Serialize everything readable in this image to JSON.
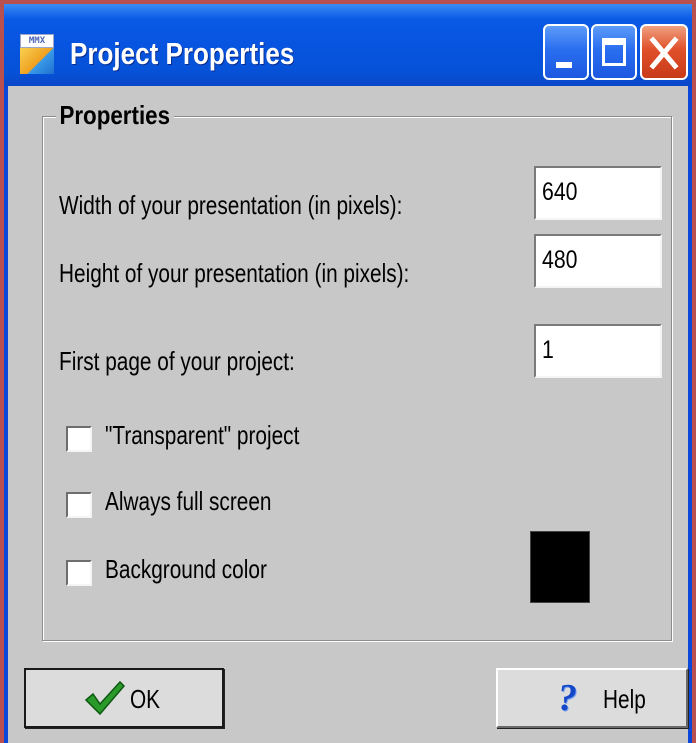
{
  "window": {
    "title": "Project Properties",
    "icon_text": "MMX",
    "controls": [
      "minimize-icon",
      "maximize-icon",
      "close-icon"
    ]
  },
  "group": {
    "legend": "Properties"
  },
  "fields": {
    "width_label": "Width of your presentation (in pixels):",
    "width_value": "640",
    "height_label": "Height of your presentation (in pixels):",
    "height_value": "480",
    "first_page_label": "First page of your project:",
    "first_page_value": "1"
  },
  "options": {
    "transparent_label": "\"Transparent\" project",
    "transparent_checked": false,
    "fullscreen_label": "Always full screen",
    "fullscreen_checked": false,
    "bg_color_label": "Background color",
    "bg_color_checked": false,
    "bg_color_value": "#000000"
  },
  "buttons": {
    "ok_label": "OK",
    "ok_icon": "checkmark-icon",
    "help_label": "Help",
    "help_icon": "question-mark-icon"
  },
  "colors": {
    "titlebar": "#0754e0",
    "dialog_bg": "#c8c8c8",
    "close_button": "#e0502a",
    "checkmark": "#2a9a2a",
    "help_icon": "#1548c8"
  }
}
